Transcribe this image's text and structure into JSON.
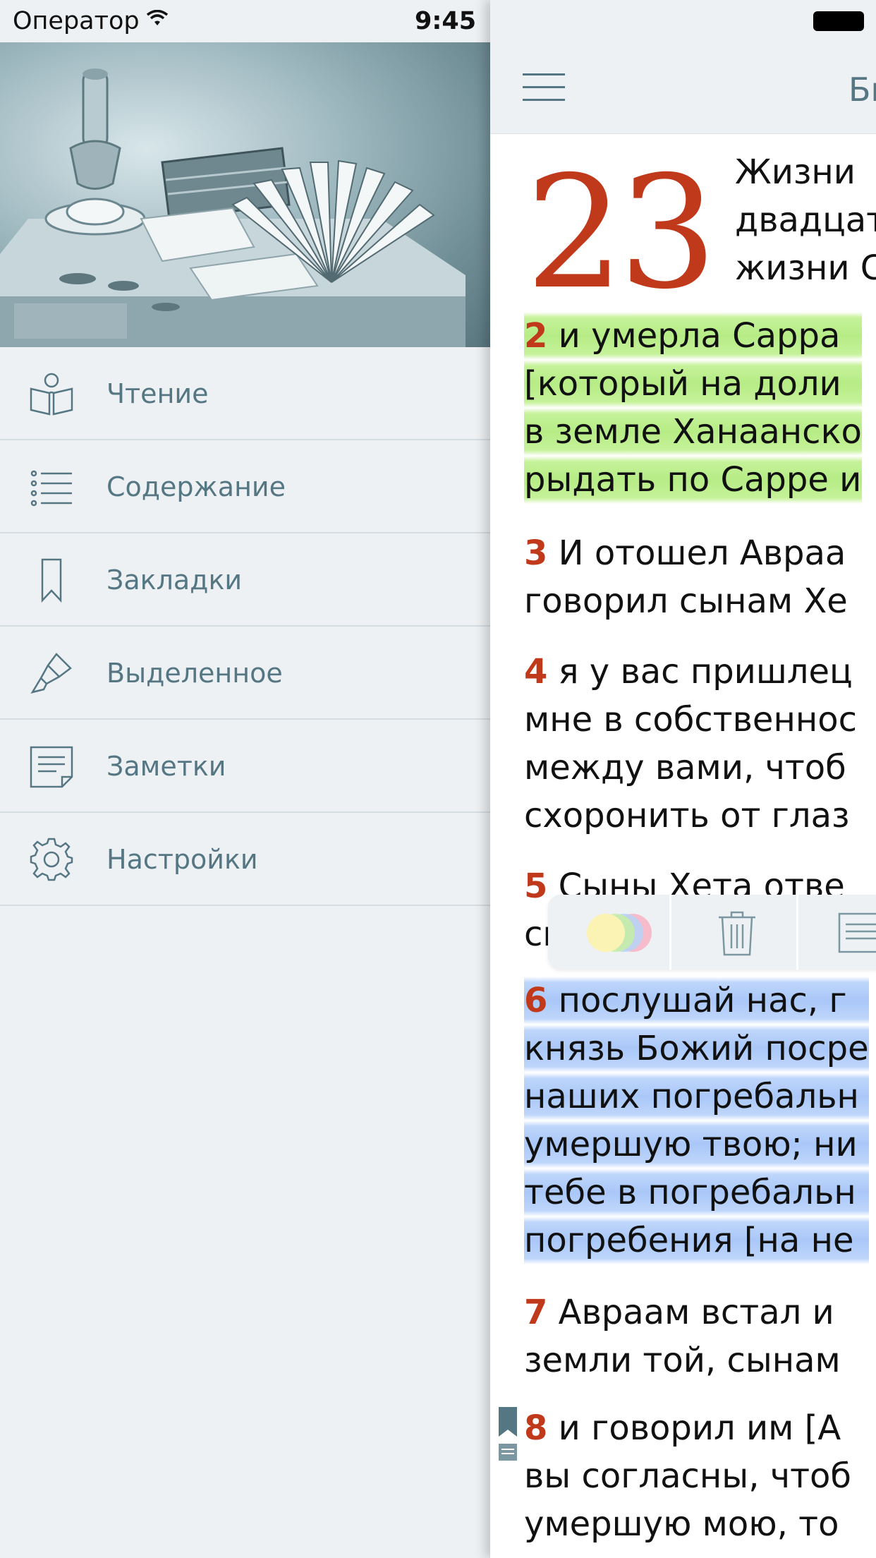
{
  "status": {
    "carrier": "Оператор",
    "time": "9:45"
  },
  "menu": {
    "items": [
      {
        "label": "Чтение",
        "icon": "book-reader-icon"
      },
      {
        "label": "Содержание",
        "icon": "list-icon"
      },
      {
        "label": "Закладки",
        "icon": "bookmark-icon"
      },
      {
        "label": "Выделенное",
        "icon": "highlighter-icon"
      },
      {
        "label": "Заметки",
        "icon": "note-icon"
      },
      {
        "label": "Настройки",
        "icon": "gear-icon"
      }
    ]
  },
  "reader": {
    "title": "Бы",
    "chapter_number": "23",
    "chapter_intro": [
      "Жизни",
      "двадцат",
      "жизни С"
    ],
    "verses": [
      {
        "num": "2",
        "lines": [
          " и умерла Сарра",
          "[который на доли",
          "в земле Ханаанско",
          "рыдать по Сарре и"
        ],
        "highlight": "green"
      },
      {
        "num": "3",
        "lines": [
          " И отошел Авраа",
          "говорил сынам Хе"
        ],
        "highlight": "none"
      },
      {
        "num": "4",
        "lines": [
          " я у вас пришлец",
          "мне в собственнос",
          "между вами, чтоб",
          "схоронить от глаз"
        ],
        "highlight": "none"
      },
      {
        "num": "5",
        "lines": [
          " Сыны Хета отве",
          "ск"
        ],
        "highlight": "none"
      },
      {
        "num": "6",
        "lines": [
          " послушай нас, г",
          "князь Божий посре",
          "наших погребальн",
          "умершую твою; ни",
          "тебе в погребальн",
          "погребения [на не"
        ],
        "highlight": "blue"
      },
      {
        "num": "7",
        "lines": [
          " Авраам встал и",
          "земли той, сынам"
        ],
        "highlight": "none"
      },
      {
        "num": "8",
        "lines": [
          " и говорил им [А",
          "вы согласны, чтоб",
          "умершую мою, то"
        ],
        "highlight": "none"
      }
    ]
  },
  "colors": {
    "accent": "#557683",
    "verse_number": "#c0391b",
    "highlight_green": "#b6ec85",
    "highlight_blue": "#a9c7f8"
  }
}
